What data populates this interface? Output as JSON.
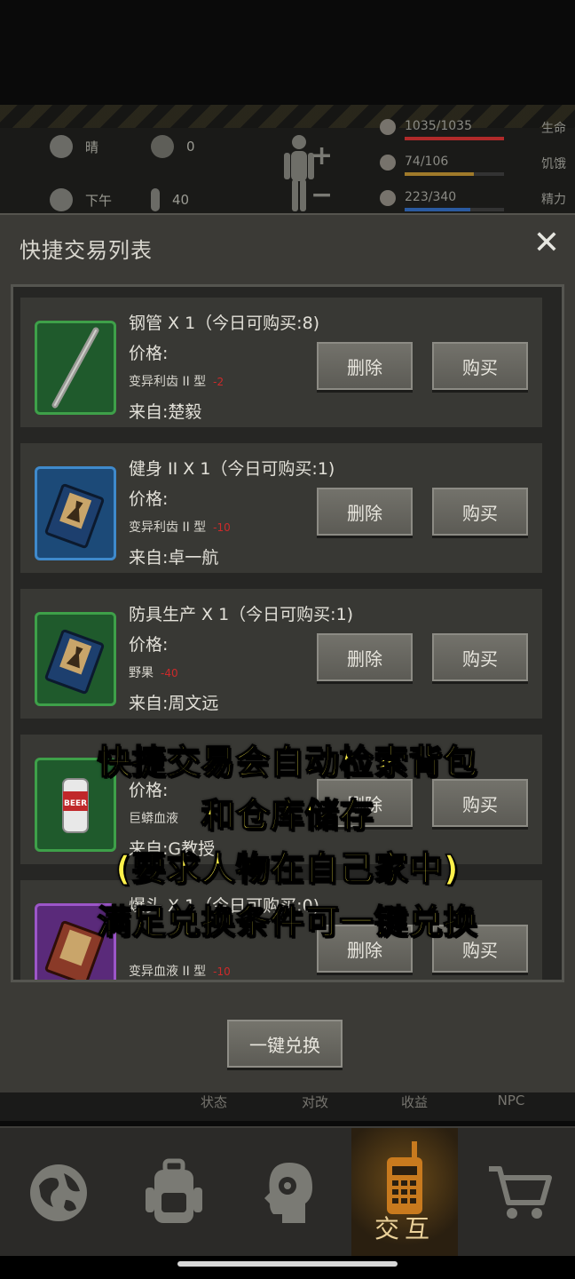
{
  "hud": {
    "weather": "晴",
    "radiation": "0",
    "time": "下午",
    "temperature": "40",
    "stats": [
      {
        "value": "1035/1035",
        "label": "生命",
        "fill": 1.0,
        "color": "#b02a2a"
      },
      {
        "value": "74/106",
        "label": "饥饿",
        "fill": 0.7,
        "color": "#a07a2a"
      },
      {
        "value": "223/340",
        "label": "精力",
        "fill": 0.66,
        "color": "#2a5aa0"
      }
    ]
  },
  "dialog": {
    "title": "快捷交易列表",
    "close_label": "✕",
    "one_key_label": "一键兑换"
  },
  "items": [
    {
      "name": "钢管 X 1（今日可购买:8)",
      "price_label": "价格:",
      "cost_item": "变异利齿 II 型",
      "cost_qty": "-2",
      "source": "来自:楚毅",
      "delete": "删除",
      "buy": "购买",
      "thumb": "green",
      "icon": "pipe-icon"
    },
    {
      "name": "健身 II X 1（今日可购买:1)",
      "price_label": "价格:",
      "cost_item": "变异利齿 II 型",
      "cost_qty": "-10",
      "source": "来自:卓一航",
      "delete": "删除",
      "buy": "购买",
      "thumb": "blue",
      "icon": "book-icon"
    },
    {
      "name": "防具生产 X 1（今日可购买:1)",
      "price_label": "价格:",
      "cost_item": "野果",
      "cost_qty": "-40",
      "source": "来自:周文远",
      "delete": "删除",
      "buy": "购买",
      "thumb": "green",
      "icon": "book-icon"
    },
    {
      "name": "",
      "price_label": "价格:",
      "cost_item": "巨蟒血液",
      "cost_qty": "",
      "source": "来自:G教授",
      "delete": "删除",
      "buy": "购买",
      "thumb": "green",
      "icon": "beer-can-icon"
    },
    {
      "name": "爆头 X 1（今日可购买:0)",
      "price_label": "",
      "cost_item": "变异血液 II 型",
      "cost_qty": "-10",
      "source": "",
      "delete": "删除",
      "buy": "购买",
      "thumb": "purple",
      "icon": "book-icon"
    }
  ],
  "subtabs": [
    "状态",
    "对改",
    "收益",
    "NPC"
  ],
  "nav": {
    "active_label": "交互",
    "items": [
      "world-map-icon",
      "backpack-icon",
      "head-gear-icon",
      "walkie-talkie-icon",
      "cart-icon"
    ]
  },
  "caption": {
    "line1": "快捷交易会自动检索背包",
    "line2": "和仓库储存",
    "line3": "(要求人物在自己家中)",
    "line4": "满足兑换条件可一键兑换"
  }
}
